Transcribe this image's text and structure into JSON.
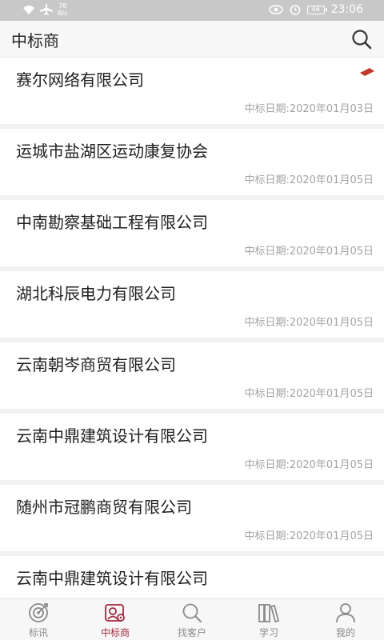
{
  "status": {
    "speed": "78",
    "speed_unit": "B/s",
    "battery": "46",
    "time": "23:06"
  },
  "header": {
    "title": "中标商"
  },
  "list": [
    {
      "name": "赛尔网络有限公司",
      "date": "中标日期:2020年01月03日",
      "badge": true
    },
    {
      "name": "运城市盐湖区运动康复协会",
      "date": "中标日期:2020年01月05日"
    },
    {
      "name": "中南勘察基础工程有限公司",
      "date": "中标日期:2020年01月05日"
    },
    {
      "name": "湖北科辰电力有限公司",
      "date": "中标日期:2020年01月05日"
    },
    {
      "name": "云南朝岑商贸有限公司",
      "date": "中标日期:2020年01月05日"
    },
    {
      "name": "云南中鼎建筑设计有限公司",
      "date": "中标日期:2020年01月05日"
    },
    {
      "name": "随州市冠鹏商贸有限公司",
      "date": "中标日期:2020年01月05日"
    },
    {
      "name": "云南中鼎建筑设计有限公司",
      "date": ""
    }
  ],
  "tabs": [
    {
      "label": "标讯",
      "icon": "target-icon"
    },
    {
      "label": "中标商",
      "icon": "bidder-icon"
    },
    {
      "label": "找客户",
      "icon": "search-icon"
    },
    {
      "label": "学习",
      "icon": "books-icon"
    },
    {
      "label": "我的",
      "icon": "person-icon"
    }
  ],
  "colors": {
    "accent": "#9e2a3d",
    "badge": "#c0392b"
  }
}
